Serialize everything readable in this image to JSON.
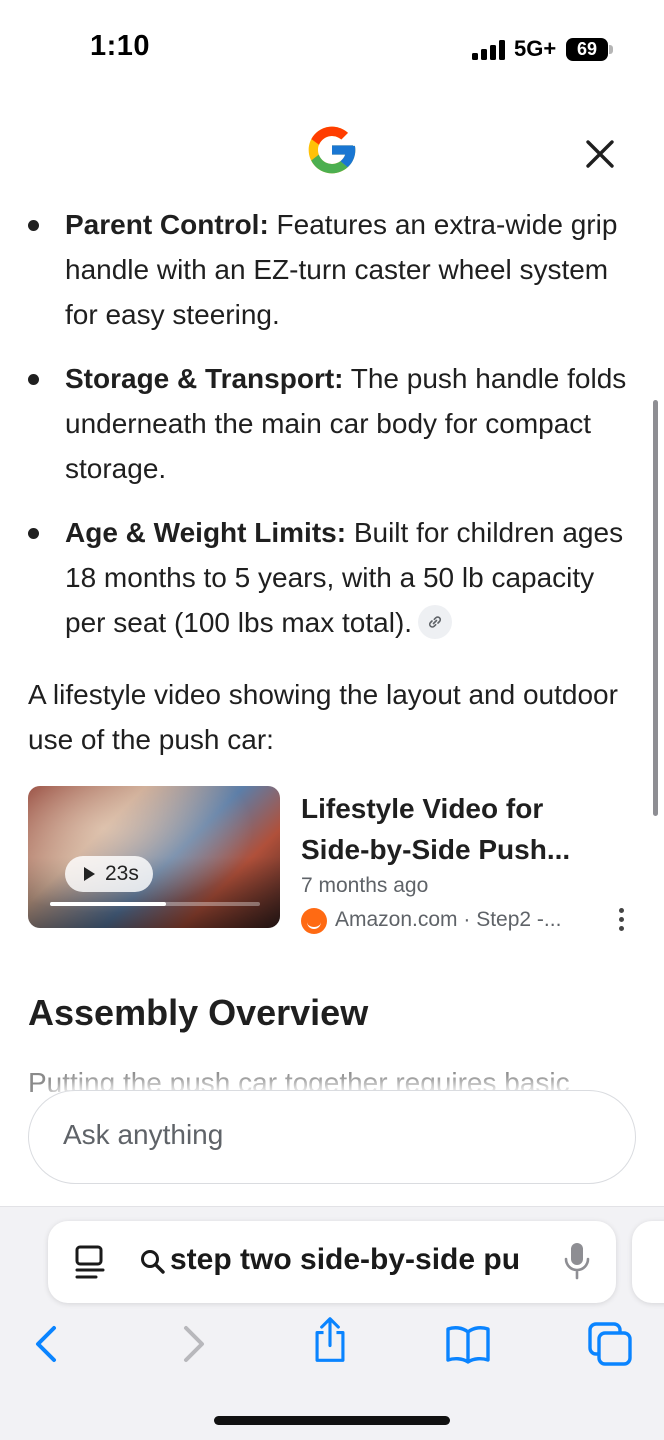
{
  "status_bar": {
    "time": "1:10",
    "network": "5G+",
    "battery": "69"
  },
  "header": {
    "logo_icon": "google-g-icon",
    "close_icon": "close-icon"
  },
  "bullets": [
    {
      "title": "Parent Control:",
      "text": " Features an extra-wide grip handle with an EZ-turn caster wheel system for easy steering."
    },
    {
      "title": "Storage & Transport:",
      "text": " The push handle folds underneath the main car body for compact storage."
    },
    {
      "title": "Age & Weight Limits:",
      "text": " Built for children ages 18 months to 5 years, with a 50 lb capacity per seat (100 lbs max total)."
    }
  ],
  "intro_text": "A lifestyle video showing the layout and outdoor use of the push car:",
  "video": {
    "duration": "23s",
    "progress_fraction": 0.55,
    "title": "Lifestyle Video for Side-by-Side Push...",
    "age": "7 months ago",
    "source": "Amazon.com · Step2 -..."
  },
  "section_heading": "Assembly Overview",
  "faded_text": "Putting the push car together requires basic",
  "ask_box": {
    "placeholder": "Ask anything"
  },
  "safari": {
    "url_text": "step two side-by-side pu",
    "toolbar": [
      "back-icon",
      "forward-icon",
      "share-icon",
      "bookmarks-icon",
      "tabs-icon"
    ]
  },
  "colors": {
    "accent_blue": "#0a84ff",
    "amazon_orange": "#ff6a13",
    "text": "#1f1f1f",
    "muted": "#5f6368"
  }
}
